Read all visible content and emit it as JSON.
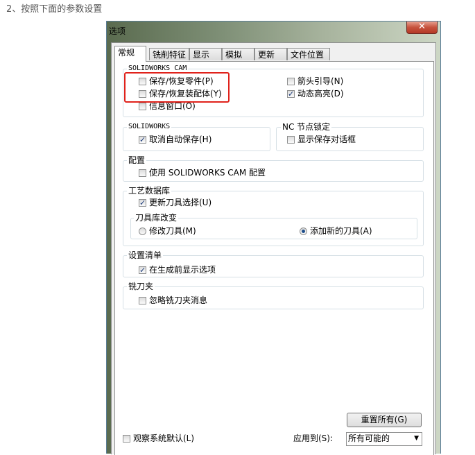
{
  "caption": "2、按照下面的参数设置",
  "dialog": {
    "title": "选项",
    "close_glyph": "✕",
    "tabs": [
      "常规",
      "铣削特征",
      "显示",
      "模拟",
      "更新",
      "文件位置"
    ]
  },
  "groups": {
    "solidworks_cam": {
      "label": "SOLIDWORKS CAM",
      "save_restore_part": "保存/恢复零件(P)",
      "save_restore_assembly": "保存/恢复装配体(Y)",
      "info_window": "信息窗口(O)",
      "arrow_guide": "箭头引导(N)",
      "dynamic_highlight": "动态高亮(D)"
    },
    "solidworks": {
      "label": "SOLIDWORKS",
      "cancel_autosave": "取消自动保存(H)"
    },
    "nc_lock": {
      "label": "NC 节点锁定",
      "show_save_dialog": "显示保存对话框"
    },
    "config": {
      "label": "配置",
      "use_config": "使用 SOLIDWORKS CAM 配置"
    },
    "tech_db": {
      "label": "工艺数据库",
      "update_tool_selection": "更新刀具选择(U)",
      "tool_lib_label": "刀具库改变",
      "modify_tool": "修改刀具(M)",
      "add_new_tool": "添加新的刀具(A)"
    },
    "setup_list": {
      "label": "设置清单",
      "show_before_gen": "在生成前显示选项"
    },
    "chuck": {
      "label": "铣刀夹",
      "ignore_chuck_msg": "忽略铣刀夹消息"
    }
  },
  "footer": {
    "reset_all": "重置所有(G)",
    "watch_default": "观察系统默认(L)",
    "apply_to_label": "应用到(S):",
    "apply_to_value": "所有可能的"
  }
}
